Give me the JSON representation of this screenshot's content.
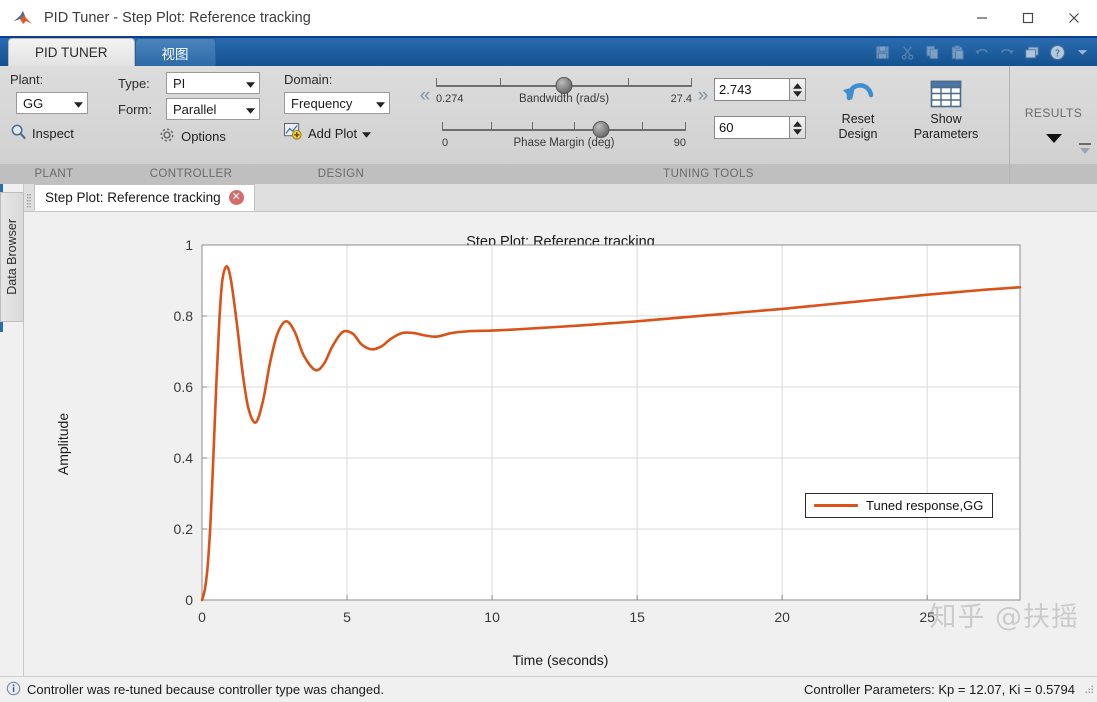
{
  "window": {
    "title": "PID Tuner - Step Plot: Reference tracking",
    "logo_icon": "matlab-membrane-icon",
    "minimize_icon": "minimize-icon",
    "maximize_icon": "maximize-icon",
    "close_icon": "close-icon"
  },
  "ribbon": {
    "tabs": [
      {
        "label": "PID TUNER",
        "active": true
      },
      {
        "label": "视图",
        "active": false
      }
    ],
    "quick_access": [
      {
        "name": "save-icon",
        "label": "Save"
      },
      {
        "name": "cut-icon",
        "label": "Cut"
      },
      {
        "name": "copy-icon",
        "label": "Copy"
      },
      {
        "name": "paste-icon",
        "label": "Paste"
      },
      {
        "name": "undo-icon",
        "label": "Undo"
      },
      {
        "name": "redo-icon",
        "label": "Redo"
      },
      {
        "name": "layout-icon",
        "label": "Layout"
      },
      {
        "name": "help-icon",
        "label": "Help"
      },
      {
        "name": "chevron-down-icon",
        "label": "More"
      }
    ],
    "groups": {
      "plant": {
        "title": "PLANT",
        "plant_label": "Plant:",
        "plant_value": "GG",
        "inspect_label": "Inspect"
      },
      "controller": {
        "title": "CONTROLLER",
        "type_label": "Type:",
        "type_value": "PI",
        "form_label": "Form:",
        "form_value": "Parallel",
        "options_label": "Options"
      },
      "design": {
        "title": "DESIGN",
        "domain_label": "Domain:",
        "domain_value": "Frequency",
        "add_plot_label": "Add Plot"
      },
      "tuning": {
        "title": "TUNING TOOLS",
        "bandwidth": {
          "caption": "Bandwidth (rad/s)",
          "min": "0.274",
          "max": "27.4",
          "value": "2.743",
          "thumb_pct": 50
        },
        "phase_margin": {
          "caption": "Phase Margin (deg)",
          "min": "0",
          "max": "90",
          "value": "60",
          "thumb_pct": 65
        },
        "reset_design_label": "Reset\nDesign",
        "reset_design_line1": "Reset",
        "reset_design_line2": "Design",
        "show_parameters_line1": "Show",
        "show_parameters_line2": "Parameters"
      },
      "results": {
        "title": "RESULTS",
        "caret_icon": "chevron-down-icon",
        "collapse_icon": "collapse-ribbon-icon"
      }
    }
  },
  "sidebar": {
    "data_browser_label": "Data Browser"
  },
  "document": {
    "tab_label": "Step Plot: Reference tracking",
    "close_icon": "close-tab-icon"
  },
  "statusbar": {
    "info_icon": "info-icon",
    "message": "Controller was re-tuned because controller type was changed.",
    "parameters": "Controller Parameters: Kp = 12.07, Ki = 0.5794",
    "resize_grip_icon": "resize-grip-icon"
  },
  "watermark": "知乎 @扶摇",
  "colors": {
    "line": "#D95319",
    "titlebar_accent": "#0b3d91",
    "ribbon_blue": "#1b5a9e"
  },
  "chart_data": {
    "type": "line",
    "title": "Step Plot: Reference tracking",
    "xlabel": "Time (seconds)",
    "ylabel": "Amplitude",
    "xlim": [
      0,
      28.2
    ],
    "ylim": [
      0,
      1
    ],
    "xticks": [
      0,
      5,
      10,
      15,
      20,
      25
    ],
    "yticks": [
      0,
      0.2,
      0.4,
      0.6,
      0.8,
      1
    ],
    "grid": true,
    "legend": {
      "position": "top-right",
      "entries": [
        {
          "name": "Tuned response,GG",
          "color": "#D95319"
        }
      ]
    },
    "series": [
      {
        "name": "Tuned response,GG",
        "color": "#D95319",
        "x": [
          0,
          0.1,
          0.2,
          0.3,
          0.4,
          0.5,
          0.6,
          0.7,
          0.85,
          1.0,
          1.2,
          1.4,
          1.6,
          1.85,
          2.1,
          2.35,
          2.6,
          2.9,
          3.2,
          3.5,
          3.9,
          4.2,
          4.5,
          4.85,
          5.2,
          5.5,
          5.85,
          6.2,
          6.5,
          6.9,
          7.3,
          7.7,
          8.1,
          8.6,
          9.2,
          10.0,
          11.0,
          12.0,
          13.0,
          14.0,
          15.0,
          16.0,
          17.0,
          18.0,
          19.0,
          20.0,
          21.0,
          22.0,
          23.0,
          24.0,
          25.0,
          26.0,
          27.0,
          28.2
        ],
        "y": [
          0,
          0.03,
          0.1,
          0.23,
          0.42,
          0.62,
          0.79,
          0.9,
          0.94,
          0.9,
          0.78,
          0.64,
          0.54,
          0.5,
          0.56,
          0.67,
          0.75,
          0.785,
          0.755,
          0.69,
          0.648,
          0.665,
          0.715,
          0.755,
          0.75,
          0.72,
          0.706,
          0.715,
          0.735,
          0.752,
          0.752,
          0.745,
          0.742,
          0.752,
          0.757,
          0.759,
          0.763,
          0.768,
          0.773,
          0.779,
          0.785,
          0.792,
          0.799,
          0.806,
          0.813,
          0.82,
          0.828,
          0.836,
          0.844,
          0.852,
          0.86,
          0.867,
          0.874,
          0.881
        ]
      }
    ]
  }
}
